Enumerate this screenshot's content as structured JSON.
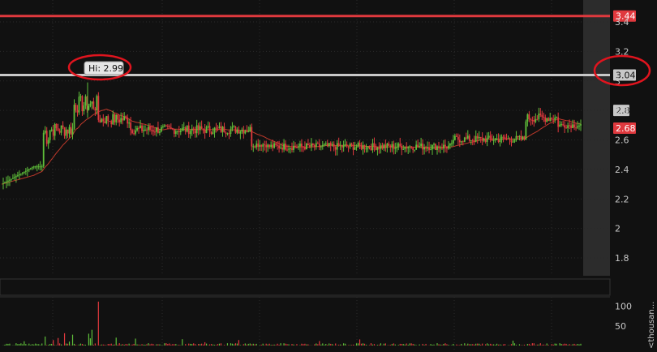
{
  "chart_data": {
    "type": "candlestick",
    "price_axis": {
      "min": 1.7,
      "max": 3.5,
      "ticks": [
        "3.4",
        "3.2",
        "3",
        "2.8",
        "2.6",
        "2.4",
        "2.2",
        "2",
        "1.8"
      ]
    },
    "volume_axis": {
      "max": 120,
      "ticks": [
        "100",
        "50"
      ],
      "label": "<thousan..."
    },
    "levels": [
      {
        "value": 3.44,
        "label": "3.44",
        "color": "#e0393e"
      },
      {
        "value": 3.04,
        "label": "3.04",
        "color": "#c8c8c8"
      },
      {
        "value": 2.8,
        "label": "2.8",
        "color": "#c8c8c8"
      },
      {
        "value": 2.68,
        "label": "2.68",
        "color": "#e0393e"
      }
    ],
    "high_callout": {
      "value": 2.99,
      "label": "Hi: 2.99"
    },
    "colors": {
      "up": "#5fbf3a",
      "down": "#e0393e",
      "background": "#111111",
      "grid": "#2a2a2a",
      "annotation_circle": "#e0141e",
      "moving_average": "#c0392b"
    }
  }
}
